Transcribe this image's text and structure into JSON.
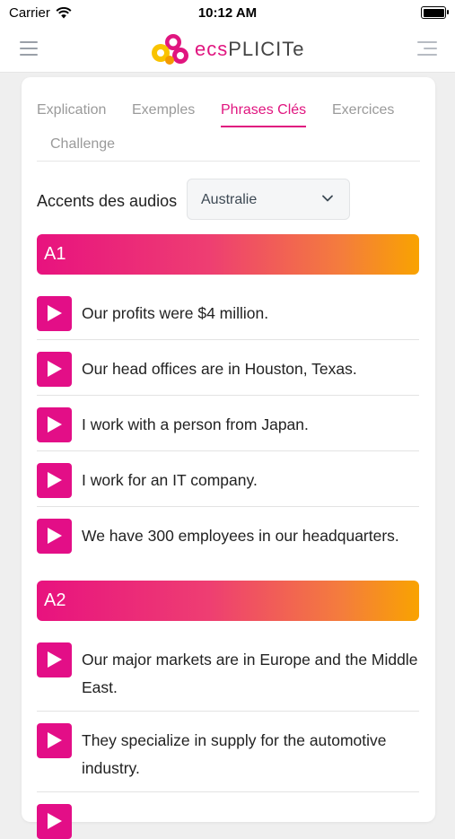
{
  "status_bar": {
    "carrier": "Carrier",
    "time": "10:12 AM"
  },
  "header": {
    "logo": {
      "text_pink": "ecs",
      "text_grey": "PLICITe"
    }
  },
  "tabs": [
    {
      "label": "Explication",
      "active": false
    },
    {
      "label": "Exemples",
      "active": false
    },
    {
      "label": "Phrases Clés",
      "active": true
    },
    {
      "label": "Exercices",
      "active": false
    },
    {
      "label": "Challenge",
      "active": false
    }
  ],
  "accent": {
    "label": "Accents des audios",
    "selected": "Australie"
  },
  "levels": [
    {
      "title": "A1",
      "phrases": [
        "Our profits were $4 million.",
        "Our head offices are in Houston, Texas.",
        "I work with a person from Japan.",
        "I work for an IT company.",
        "We have 300 employees in our headquarters."
      ]
    },
    {
      "title": "A2",
      "phrases": [
        "Our major markets are in Europe and the Middle East.",
        "They specialize in supply for the automotive industry."
      ]
    }
  ],
  "colors": {
    "accent": "#e0157f",
    "play_button": "#e30e87",
    "gradient_end": "#f9a300"
  },
  "icons": {
    "play": "play-icon",
    "chevron": "chevron-down-icon",
    "wifi": "wifi-icon",
    "battery": "battery-icon",
    "hamburger": "hamburger-menu-icon",
    "right_menu": "right-menu-icon"
  }
}
